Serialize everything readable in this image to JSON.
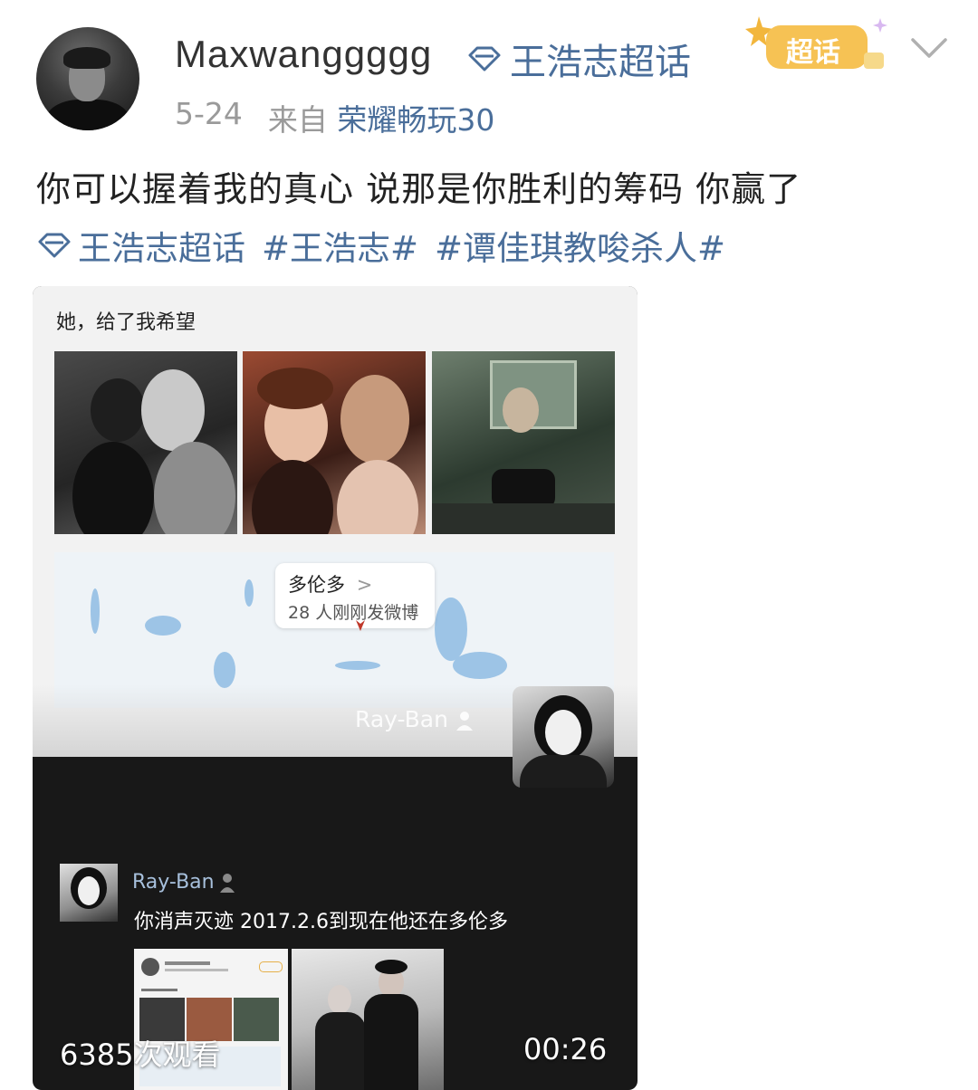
{
  "post": {
    "username": "Maxwanggggg",
    "supertopic_link": "王浩志超话",
    "badge": "超话",
    "date": "5-24",
    "from_label": "来自",
    "device": "荣耀畅玩30",
    "text": "你可以握着我的真心 说那是你胜利的筹码 你赢了",
    "tags": {
      "supertopic": "王浩志超话",
      "tag1": "#王浩志#",
      "tag2": "#谭佳琪教唆杀人#"
    }
  },
  "video": {
    "caption": "她，给了我希望",
    "map": {
      "city": "多伦多",
      "chevron": ">",
      "count": "28 人刚刚发微博"
    },
    "watermark": "Ray-Ban",
    "comment": {
      "name": "Ray-Ban",
      "text": "你消声灭迹 2017.2.6到现在他还在多伦多"
    },
    "views": "6385次观看",
    "duration": "00:26"
  },
  "colors": {
    "link": "#4a6e9a",
    "meta": "#9a9a9a",
    "badge": "#f2b63c"
  },
  "icons": [
    "supertopic-diamond-icon",
    "supertopic-badge-icon",
    "chevron-down-icon",
    "map-pin-icon",
    "person-icon"
  ]
}
